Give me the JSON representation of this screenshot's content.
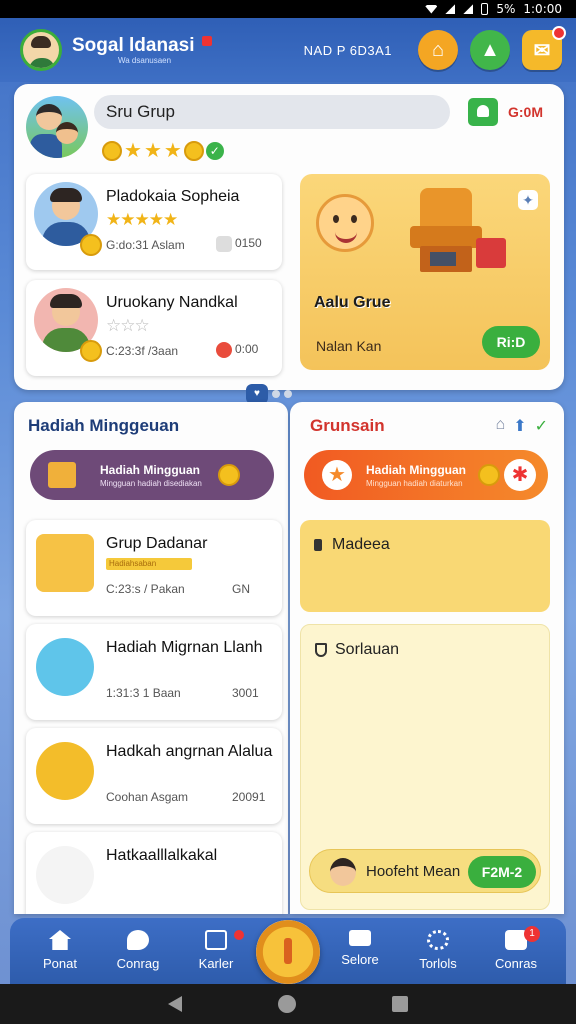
{
  "status_bar": {
    "time": "1:0:00",
    "battery": "5%"
  },
  "app": {
    "title": "Sogal ldanasi",
    "subtitle": "Wa dsanusaen",
    "code": "NAD P 6D3A1"
  },
  "group": {
    "name": "Sru Grup",
    "code": "G:0M",
    "stars": 3
  },
  "members": [
    {
      "name": "Pladokaia Sopheia",
      "meta": "G:do:31 Aslam",
      "stat": "0150",
      "stars_gold": 5,
      "stars_grey": 0,
      "shirt": "#2e5c9e",
      "bg": "#9fc9ef"
    },
    {
      "name": "Uruokany Nandkal",
      "meta": "C:23:3f /3aan",
      "stat": "0:00",
      "stars_gold": 0,
      "stars_grey": 3,
      "shirt": "#4f8a3a",
      "bg": "#f2b6b0"
    }
  ],
  "featured": {
    "label": "Aalu Grue",
    "sub": "Nalan Kan",
    "button": "Ri:D"
  },
  "weekly": {
    "title": "Hadiah Minggeuan",
    "banner_title": "Hadiah Mingguan",
    "banner_sub": "Mingguan hadiah disediakan",
    "rewards": [
      {
        "title": "Grup Dadanar",
        "meta": "C:23:s / Pakan",
        "stat": "GN",
        "tag": "Hadiahsaban",
        "icon_bg": "#f6c245"
      },
      {
        "title": "Hadiah Migrnan Llanh",
        "meta": "1:31:3 1 Baan",
        "stat": "3001",
        "tag": "",
        "icon_bg": "#5fc5ea"
      },
      {
        "title": "Hadkah angrnan Alalua",
        "meta": "Coohan Asgam",
        "stat": "20091",
        "tag": "",
        "icon_bg": "#f3bd2a"
      },
      {
        "title": "Hatkaalllalkakal",
        "meta": "",
        "stat": "",
        "tag": "",
        "icon_bg": "#f4f4f4"
      }
    ]
  },
  "right": {
    "title": "Grunsain",
    "banner_title": "Hadiah Mingguan",
    "banner_sub": "Mingguan hadiah diaturkan",
    "note_label": "Madeea",
    "notes_label": "Sorlauan",
    "pill_text": "Hoofeht Mean",
    "pill_button": "F2M-2"
  },
  "nav": {
    "items": [
      {
        "label": "Ponat"
      },
      {
        "label": "Conrag"
      },
      {
        "label": "Karler"
      },
      {
        "label": "Selore"
      },
      {
        "label": "Torlols"
      },
      {
        "label": "Conras"
      }
    ],
    "games_badge": "1"
  },
  "colors": {
    "accent_blue": "#3e6fc4",
    "accent_green": "#3aaf3e",
    "accent_orange": "#f58a2b",
    "accent_red": "#d2342d"
  }
}
